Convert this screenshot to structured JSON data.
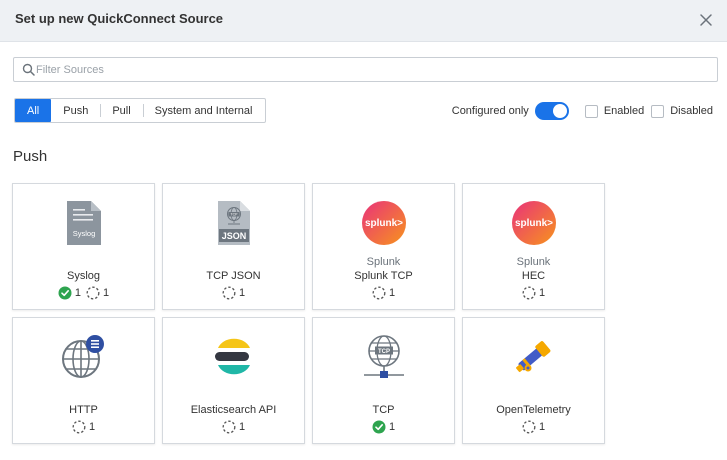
{
  "header": {
    "title": "Set up new QuickConnect Source"
  },
  "search": {
    "placeholder": "Filter Sources"
  },
  "tabs": [
    {
      "label": "All",
      "active": true
    },
    {
      "label": "Push",
      "active": false
    },
    {
      "label": "Pull",
      "active": false
    },
    {
      "label": "System and Internal",
      "active": false
    }
  ],
  "filters": {
    "configured_only_label": "Configured only",
    "configured_only_on": true,
    "enabled_label": "Enabled",
    "disabled_label": "Disabled"
  },
  "section_title": "Push",
  "cards": [
    {
      "name": "Syslog",
      "vendor": "",
      "icon": "syslog-file-icon",
      "configured": "1",
      "unconfigured": "1"
    },
    {
      "name": "TCP JSON",
      "vendor": "",
      "icon": "json-file-icon",
      "configured": "",
      "unconfigured": "1"
    },
    {
      "name": "Splunk TCP",
      "vendor": "Splunk",
      "icon": "splunk-logo-icon",
      "configured": "",
      "unconfigured": "1"
    },
    {
      "name": "HEC",
      "vendor": "Splunk",
      "icon": "splunk-logo-icon",
      "configured": "",
      "unconfigured": "1"
    },
    {
      "name": "HTTP",
      "vendor": "",
      "icon": "globe-document-icon",
      "configured": "",
      "unconfigured": "1"
    },
    {
      "name": "Elasticsearch API",
      "vendor": "",
      "icon": "elasticsearch-logo-icon",
      "configured": "",
      "unconfigured": "1"
    },
    {
      "name": "TCP",
      "vendor": "",
      "icon": "globe-network-icon",
      "configured": "1",
      "unconfigured": ""
    },
    {
      "name": "OpenTelemetry",
      "vendor": "",
      "icon": "telescope-icon",
      "configured": "",
      "unconfigured": "1"
    }
  ],
  "colors": {
    "accent": "#1a73e8",
    "configured_green": "#2ea44f",
    "splunk_gradient_start": "#e9327a",
    "splunk_gradient_end": "#f7941d"
  }
}
